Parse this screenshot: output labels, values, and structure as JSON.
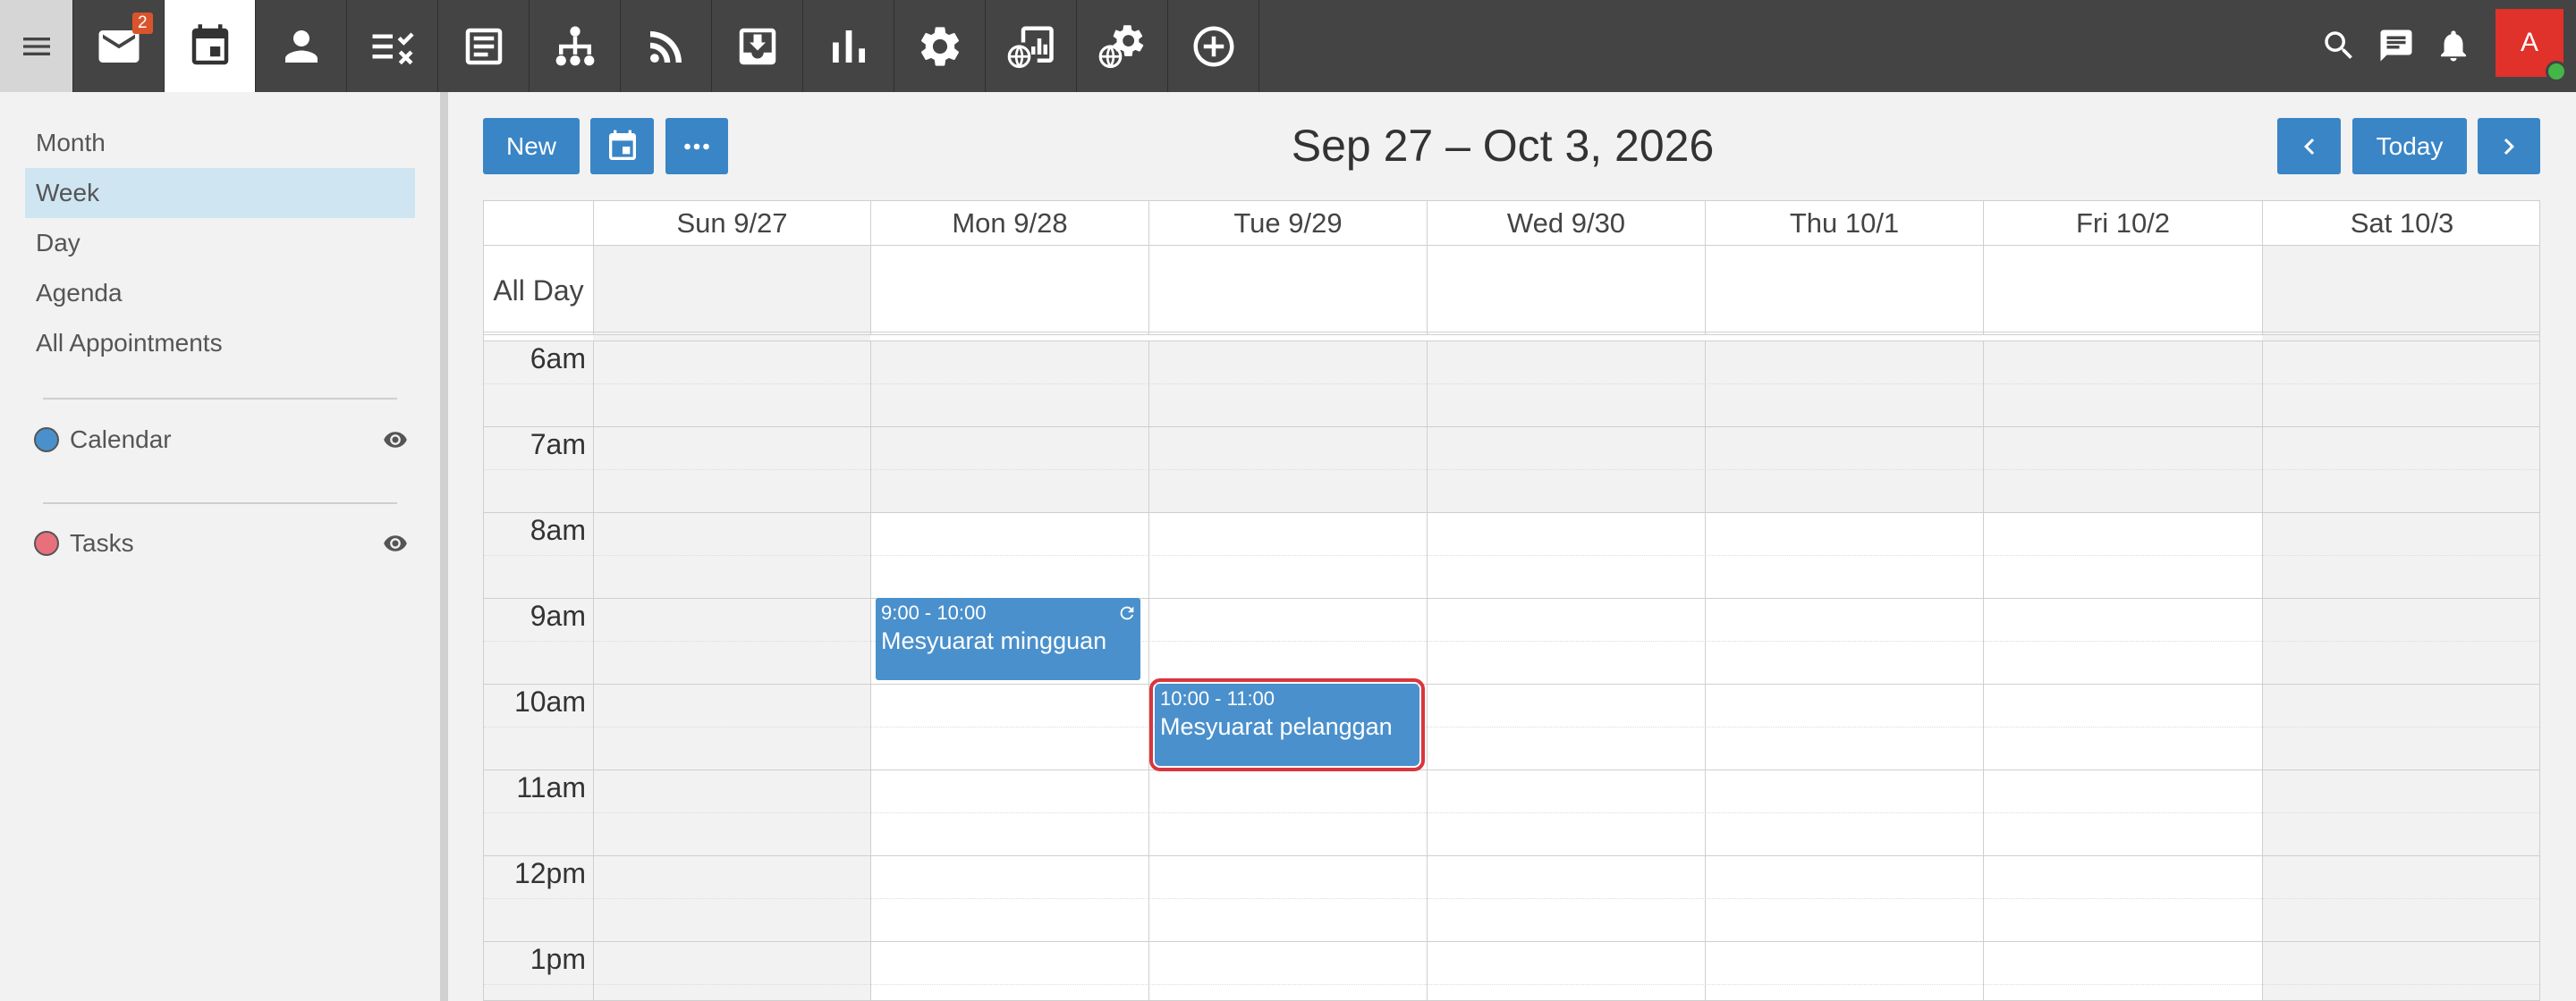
{
  "topbar": {
    "mail_badge": "2",
    "avatar_initial": "A",
    "apps": [
      {
        "name": "menu-icon"
      },
      {
        "name": "mail-icon"
      },
      {
        "name": "calendar-icon"
      },
      {
        "name": "contacts-icon"
      },
      {
        "name": "tasks-icon"
      },
      {
        "name": "notes-icon"
      },
      {
        "name": "org-chart-icon"
      },
      {
        "name": "rss-icon"
      },
      {
        "name": "inbox-download-icon"
      },
      {
        "name": "reports-icon"
      },
      {
        "name": "settings-icon"
      },
      {
        "name": "web-reports-icon"
      },
      {
        "name": "web-settings-icon"
      },
      {
        "name": "add-app-icon"
      }
    ]
  },
  "sidebar": {
    "views": [
      "Month",
      "Week",
      "Day",
      "Agenda",
      "All Appointments"
    ],
    "selected_view": "Week",
    "calendars": [
      {
        "label": "Calendar",
        "color": "#4a90cc"
      },
      {
        "label": "Tasks",
        "color": "#e8707c"
      }
    ]
  },
  "toolbar": {
    "new_label": "New",
    "today_label": "Today",
    "range_title": "Sep 27 – Oct 3, 2026"
  },
  "grid": {
    "all_day_label": "All Day",
    "days": [
      "Sun 9/27",
      "Mon 9/28",
      "Tue 9/29",
      "Wed 9/30",
      "Thu 10/1",
      "Fri 10/2",
      "Sat 10/3"
    ],
    "hours": [
      "6am",
      "7am",
      "8am",
      "9am",
      "10am",
      "11am",
      "12pm",
      "1pm"
    ],
    "events": [
      {
        "time": "9:00 - 10:00",
        "title": "Mesyuarat mingguan",
        "recurring": true
      },
      {
        "time": "10:00 - 11:00",
        "title": "Mesyuarat pelanggan",
        "selected": true
      }
    ]
  },
  "colors": {
    "accent": "#3a85c6",
    "event": "#4a90cc",
    "topbar": "#444444",
    "avatar": "#e0312b",
    "selection_outline": "#d9363e"
  }
}
